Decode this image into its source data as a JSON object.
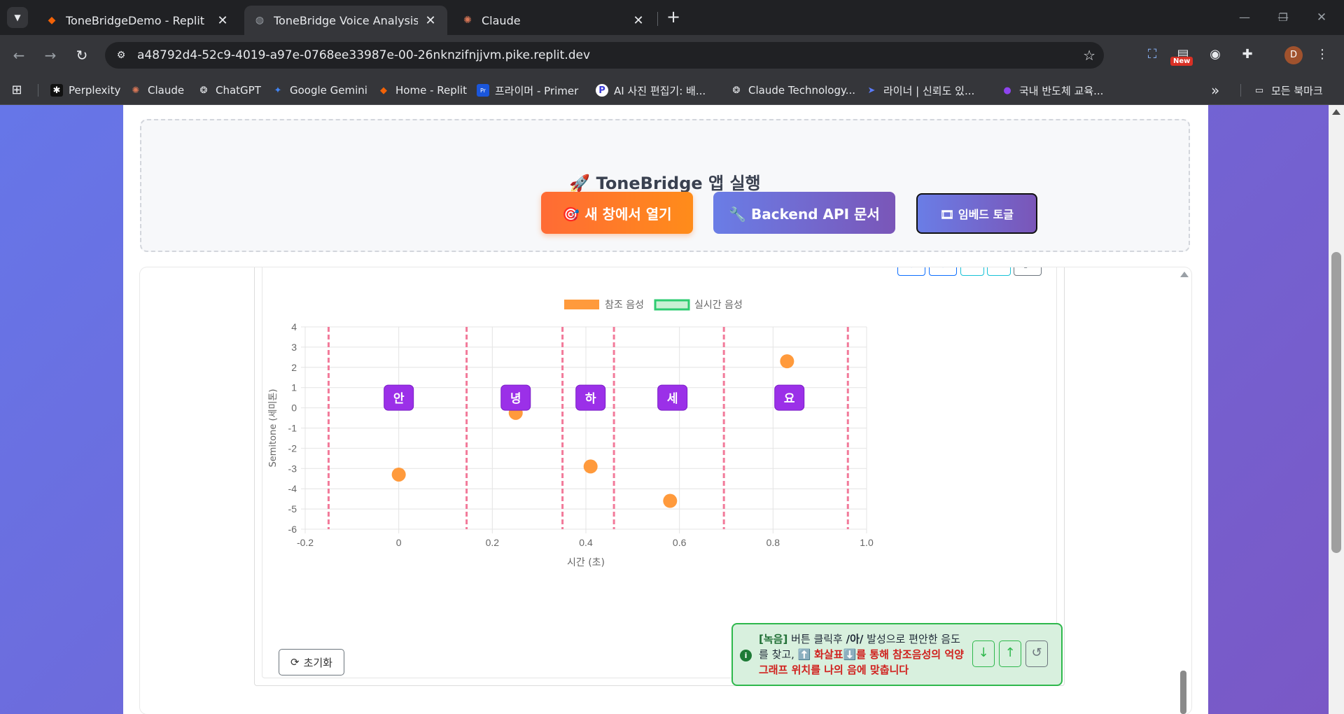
{
  "browser": {
    "tabs": [
      {
        "title": "ToneBridgeDemo - Replit",
        "active": false
      },
      {
        "title": "ToneBridge Voice Analysis - Cl",
        "active": true
      },
      {
        "title": "Claude",
        "active": false
      }
    ],
    "url": "a48792d4-52c9-4019-a97e-0768ee33987e-00-26nknzifnjjvm.pike.replit.dev",
    "new_badge": "New",
    "avatar_letter": "D",
    "bookmarks": [
      {
        "label": "Perplexity",
        "icon": "perplexity-icon",
        "color": "#20808d"
      },
      {
        "label": "Claude",
        "icon": "claude-icon",
        "color": "#d97757"
      },
      {
        "label": "ChatGPT",
        "icon": "chatgpt-icon",
        "color": "#e8eaed"
      },
      {
        "label": "Google Gemini",
        "icon": "gemini-icon",
        "color": "#4285f4"
      },
      {
        "label": "Home - Replit",
        "icon": "replit-icon",
        "color": "#f26207"
      },
      {
        "label": "프라이머 - Primer",
        "icon": "primer-icon",
        "color": "#1a56db"
      },
      {
        "label": "AI 사진 편집기: 배...",
        "icon": "photo-editor-icon",
        "color": "#3b3bd6"
      },
      {
        "label": "Claude Technology...",
        "icon": "openai-icon",
        "color": "#e8eaed"
      },
      {
        "label": "라이너 | 신뢰도 있...",
        "icon": "liner-icon",
        "color": "#5b7cfa"
      },
      {
        "label": "국내 반도체 교육...",
        "icon": "semiconductor-icon",
        "color": "#8e44ef"
      }
    ],
    "all_bookmarks": "모든 북마크"
  },
  "launch": {
    "title": "🚀 ToneBridge 앱 실행",
    "open_new_window": "🎯 새 창에서 열기",
    "api_docs": "🔧 Backend API 문서",
    "embed_toggle": "🎞 임베드 토글"
  },
  "chart_data": {
    "type": "scatter",
    "title": "",
    "xlabel": "시간 (초)",
    "ylabel": "Semitone (세미톤)",
    "xlim": [
      -0.2,
      1.0
    ],
    "ylim": [
      -6,
      4
    ],
    "x_ticks": [
      "-0.2",
      "0",
      "0.2",
      "0.4",
      "0.6",
      "0.8",
      "1.0"
    ],
    "y_ticks": [
      "4",
      "3",
      "2",
      "1",
      "0",
      "-1",
      "-2",
      "-3",
      "-4",
      "-5",
      "-6"
    ],
    "legend": [
      {
        "name": "참조 음성",
        "color": "#ff9a3c"
      },
      {
        "name": "실시간 음성",
        "color": "#2ecc71"
      }
    ],
    "legend_position": "top",
    "grid": true,
    "series": [
      {
        "name": "참조 음성",
        "color": "#ff9a3c",
        "points": [
          {
            "x": 0.0,
            "y": -3.3
          },
          {
            "x": 0.25,
            "y": -0.25
          },
          {
            "x": 0.41,
            "y": -2.9
          },
          {
            "x": 0.58,
            "y": -4.6
          },
          {
            "x": 0.83,
            "y": 2.3
          }
        ]
      },
      {
        "name": "실시간 음성",
        "color": "#2ecc71",
        "points": []
      }
    ],
    "syllable_boundaries": [
      -0.15,
      0.145,
      0.35,
      0.46,
      0.695,
      0.96
    ],
    "syllables": [
      {
        "label": "안",
        "x": 0.0
      },
      {
        "label": "녕",
        "x": 0.25
      },
      {
        "label": "하",
        "x": 0.41
      },
      {
        "label": "세",
        "x": 0.585
      },
      {
        "label": "요",
        "x": 0.835
      }
    ],
    "syllable_label_y": 0.5
  },
  "controls": {
    "reset_label": "초기화",
    "hint_prefix": "[녹음]",
    "hint_part1": " 버튼 클릭후 ",
    "hint_vowel": "/아/",
    "hint_part2": " 발성으로 편안한 음도를 찾고, ⬆️ ",
    "hint_arrow": "화살표",
    "hint_part3": "⬇️",
    "hint_red": "를 통해 참조음성의 억양 그래프 위치를 나의 음에 맞춥니다"
  }
}
